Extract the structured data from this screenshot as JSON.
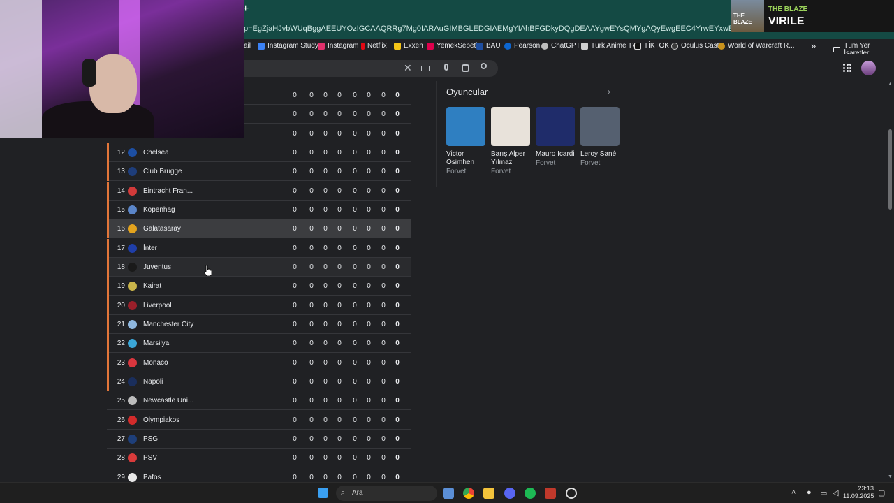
{
  "browser": {
    "new_tab": "+",
    "url": "p=EgZjaHJvbWUqBggAEEUYOzIGCAAQRRg7Mg0IARAuGIMBGLEDGIAEMgYIAhBFGDkyDQgDEAAYgwEYsQMYgAQyEwgEEC4YrwEYxwEYsQMYgAQYjgUyBggFEEUYPDIGCA",
    "bookmarks": [
      "ail",
      "Instagram Stüdyo",
      "Instagram",
      "Netflix",
      "Exxen",
      "YemekSepeti",
      "BAU",
      "Pearson",
      "ChatGPT",
      "Türk Anime TV",
      "TİKTOK",
      "Oculus Cast",
      "World of Warcraft R..."
    ],
    "bookmarks_more": "»",
    "all_bookmarks": "Tüm Yer İşaretleri"
  },
  "search_icons": [
    "clear-icon",
    "keyboard-icon",
    "mic-icon",
    "lens-icon",
    "search-icon"
  ],
  "banner": {
    "small": "THE BLAZE",
    "big": "VIRILE",
    "img_text": "THE BLAZE"
  },
  "table": {
    "rows": [
      {
        "rank": "",
        "team": "",
        "stats": [
          "0",
          "0",
          "0",
          "0",
          "0",
          "0",
          "0",
          "0"
        ],
        "crest": "#2a2b2e",
        "accent": false,
        "state": ""
      },
      {
        "rank": "",
        "team": "",
        "stats": [
          "0",
          "0",
          "0",
          "0",
          "0",
          "0",
          "0",
          "0"
        ],
        "crest": "#2a2b2e",
        "accent": false,
        "state": ""
      },
      {
        "rank": "",
        "team": "",
        "stats": [
          "0",
          "0",
          "0",
          "0",
          "0",
          "0",
          "0",
          "0"
        ],
        "crest": "#2a2b2e",
        "accent": false,
        "state": ""
      },
      {
        "rank": "12",
        "team": "Chelsea",
        "stats": [
          "0",
          "0",
          "0",
          "0",
          "0",
          "0",
          "0",
          "0"
        ],
        "crest": "#1d4fa3",
        "accent": true,
        "state": ""
      },
      {
        "rank": "13",
        "team": "Club Brugge",
        "stats": [
          "0",
          "0",
          "0",
          "0",
          "0",
          "0",
          "0",
          "0"
        ],
        "crest": "#1e3d7a",
        "accent": true,
        "state": ""
      },
      {
        "rank": "14",
        "team": "Eintracht Fran...",
        "stats": [
          "0",
          "0",
          "0",
          "0",
          "0",
          "0",
          "0",
          "0"
        ],
        "crest": "#d23a3a",
        "accent": true,
        "state": ""
      },
      {
        "rank": "15",
        "team": "Kopenhag",
        "stats": [
          "0",
          "0",
          "0",
          "0",
          "0",
          "0",
          "0",
          "0"
        ],
        "crest": "#5b86c9",
        "accent": true,
        "state": ""
      },
      {
        "rank": "16",
        "team": "Galatasaray",
        "stats": [
          "0",
          "0",
          "0",
          "0",
          "0",
          "0",
          "0",
          "0"
        ],
        "crest": "#e3a31e",
        "accent": true,
        "state": "hl"
      },
      {
        "rank": "17",
        "team": "İnter",
        "stats": [
          "0",
          "0",
          "0",
          "0",
          "0",
          "0",
          "0",
          "0"
        ],
        "crest": "#1f3ea8",
        "accent": true,
        "state": ""
      },
      {
        "rank": "18",
        "team": "Juventus",
        "stats": [
          "0",
          "0",
          "0",
          "0",
          "0",
          "0",
          "0",
          "0"
        ],
        "crest": "#1a1a1a",
        "accent": true,
        "state": "hover"
      },
      {
        "rank": "19",
        "team": "Kairat",
        "stats": [
          "0",
          "0",
          "0",
          "0",
          "0",
          "0",
          "0",
          "0"
        ],
        "crest": "#c9b44a",
        "accent": true,
        "state": ""
      },
      {
        "rank": "20",
        "team": "Liverpool",
        "stats": [
          "0",
          "0",
          "0",
          "0",
          "0",
          "0",
          "0",
          "0"
        ],
        "crest": "#9a1f2a",
        "accent": true,
        "state": ""
      },
      {
        "rank": "21",
        "team": "Manchester City",
        "stats": [
          "0",
          "0",
          "0",
          "0",
          "0",
          "0",
          "0",
          "0"
        ],
        "crest": "#8fb8e0",
        "accent": true,
        "state": ""
      },
      {
        "rank": "22",
        "team": "Marsilya",
        "stats": [
          "0",
          "0",
          "0",
          "0",
          "0",
          "0",
          "0",
          "0"
        ],
        "crest": "#3ba7d8",
        "accent": true,
        "state": ""
      },
      {
        "rank": "23",
        "team": "Monaco",
        "stats": [
          "0",
          "0",
          "0",
          "0",
          "0",
          "0",
          "0",
          "0"
        ],
        "crest": "#d9363e",
        "accent": true,
        "state": ""
      },
      {
        "rank": "24",
        "team": "Napoli",
        "stats": [
          "0",
          "0",
          "0",
          "0",
          "0",
          "0",
          "0",
          "0"
        ],
        "crest": "#1a2e5c",
        "accent": true,
        "state": ""
      },
      {
        "rank": "25",
        "team": "Newcastle Uni...",
        "stats": [
          "0",
          "0",
          "0",
          "0",
          "0",
          "0",
          "0",
          "0"
        ],
        "crest": "#bcbcbc",
        "accent": false,
        "state": ""
      },
      {
        "rank": "26",
        "team": "Olympiakos",
        "stats": [
          "0",
          "0",
          "0",
          "0",
          "0",
          "0",
          "0",
          "0"
        ],
        "crest": "#d22b2b",
        "accent": false,
        "state": ""
      },
      {
        "rank": "27",
        "team": "PSG",
        "stats": [
          "0",
          "0",
          "0",
          "0",
          "0",
          "0",
          "0",
          "0"
        ],
        "crest": "#1e3f7a",
        "accent": false,
        "state": ""
      },
      {
        "rank": "28",
        "team": "PSV",
        "stats": [
          "0",
          "0",
          "0",
          "0",
          "0",
          "0",
          "0",
          "0"
        ],
        "crest": "#d93b3b",
        "accent": false,
        "state": ""
      },
      {
        "rank": "29",
        "team": "Pafos",
        "stats": [
          "0",
          "0",
          "0",
          "0",
          "0",
          "0",
          "0",
          "0"
        ],
        "crest": "#e8e8e8",
        "accent": false,
        "state": ""
      }
    ]
  },
  "players": {
    "title": "Oyuncular",
    "next": "›",
    "items": [
      {
        "name": "Victor Osimhen",
        "pos": "Forvet",
        "bg": "#2f7fc1"
      },
      {
        "name": "Barış Alper Yılmaz",
        "pos": "Forvet",
        "bg": "#e8e2da"
      },
      {
        "name": "Mauro Icardi",
        "pos": "Forvet",
        "bg": "#1f2c6a"
      },
      {
        "name": "Leroy Sané",
        "pos": "Forvet",
        "bg": "#556070"
      }
    ]
  },
  "taskbar": {
    "search_placeholder": "Ara",
    "time": "23:13",
    "date": "11.09.2025",
    "icons": [
      "windows-start-icon",
      "taskview-icon",
      "chrome-icon",
      "files-icon",
      "discord-icon",
      "spotify-icon",
      "app-icon",
      "app2-icon"
    ]
  }
}
